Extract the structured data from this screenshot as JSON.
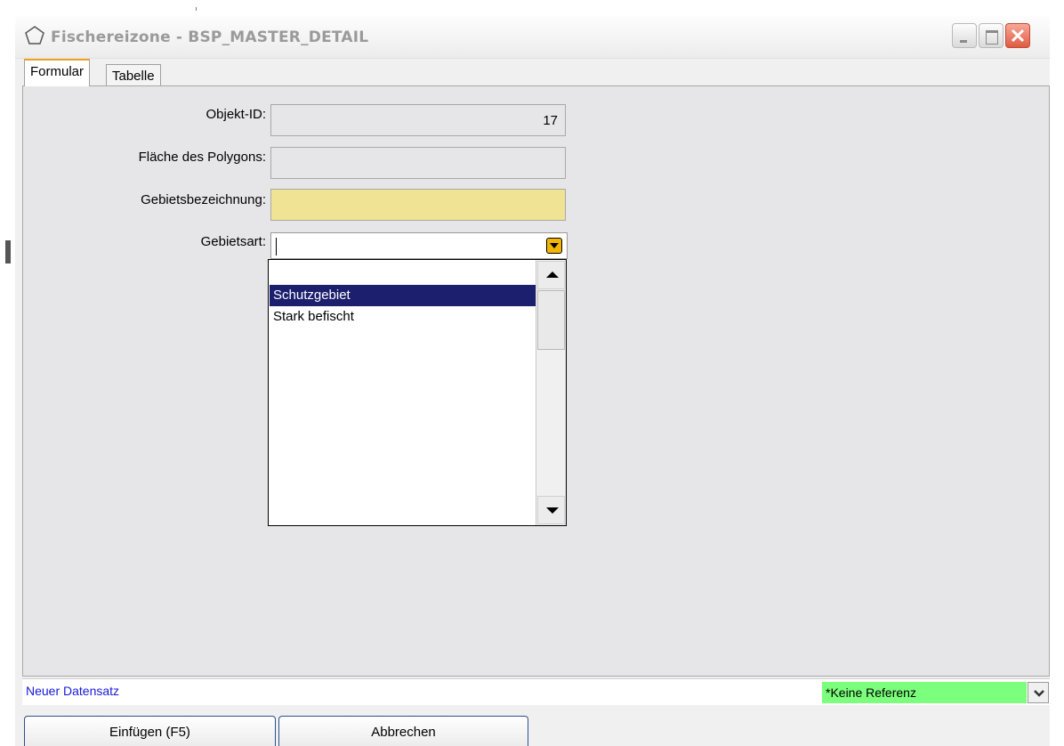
{
  "window": {
    "title": "Fischereizone - BSP_MASTER_DETAIL"
  },
  "tabs": [
    {
      "label": "Formular"
    },
    {
      "label": "Tabelle"
    }
  ],
  "form": {
    "fields": [
      {
        "label": "Objekt-ID:",
        "value": "17"
      },
      {
        "label": "Fläche des Polygons:",
        "value": ""
      },
      {
        "label": "Gebietsbezeichnung:",
        "value": ""
      },
      {
        "label": "Gebietsart:",
        "value": ""
      }
    ],
    "dropdown": {
      "options": [
        "",
        "Schutzgebiet",
        "Stark befischt"
      ],
      "highlighted": "Schutzgebiet"
    }
  },
  "status": {
    "text": "Neuer Datensatz",
    "reference": "*Keine Referenz",
    "reference_color": "#7cff7c"
  },
  "buttons": {
    "insert": "Einfügen (F5)",
    "cancel": "Abbrechen"
  }
}
